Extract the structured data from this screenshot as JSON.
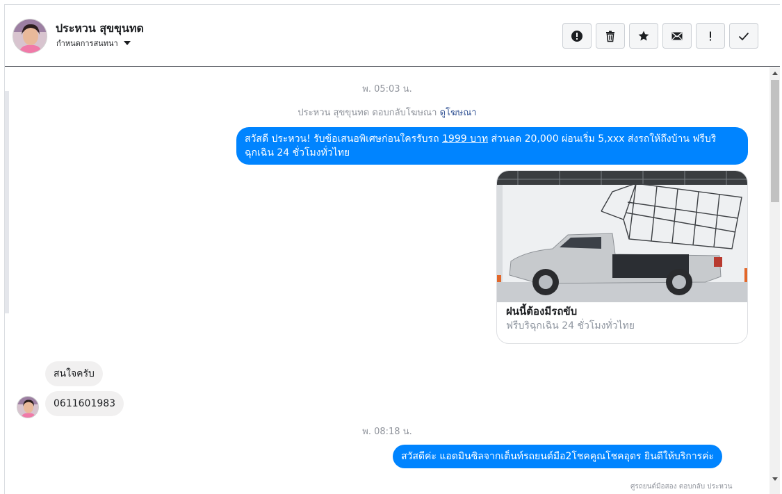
{
  "header": {
    "contact_name": "ประหวน สุขขุนทด",
    "sub_label": "กำหนดการสนทนา",
    "actions": [
      {
        "name": "report-button",
        "icon": "alert-circle-icon"
      },
      {
        "name": "delete-button",
        "icon": "trash-icon"
      },
      {
        "name": "star-button",
        "icon": "star-icon"
      },
      {
        "name": "mark-unread-button",
        "icon": "envelope-icon"
      },
      {
        "name": "important-button",
        "icon": "exclamation-icon"
      },
      {
        "name": "mark-done-button",
        "icon": "check-icon"
      }
    ]
  },
  "conversation": {
    "time_1": "พ. 05:03 น.",
    "ad_notice": {
      "text": "ประหวน สุขขุนทด ตอบกลับโฆษณา ",
      "link": "ดูโฆษณา"
    },
    "outgoing_1": {
      "part_a": "สวัสดี ประหวน! รับข้อเสนอพิเศษก่อนใครรับรถ ",
      "underline": "1999 บาท",
      "part_b": " ส่วนลด 20,000  ผ่อนเริ่ม 5,xxx ส่งรถให้ถึงบ้าน ฟรีบริ",
      "line_2": "ฉุกเฉิน 24 ชั่วโมงทั่วไทย"
    },
    "card": {
      "title": "ฝนนี้ต้องมีรถขับ",
      "subtitle": "ฟรีบริฉุกเฉิน 24 ชั่วโมงทั่วไทย"
    },
    "incoming_1": "สนใจครับ",
    "incoming_2": "0611601983",
    "time_2": "พ. 08:18 น.",
    "outgoing_2": "สวัสดีค่ะ แอดมินซิลจากเต็นท์รถยนต์มือ2โชคคูณโชคอุดร ยินดีให้บริการค่ะ",
    "cut_note": "ศูรถยนต์มือสอง ตอบกลับ ประหวน"
  },
  "colors": {
    "accent": "#0084ff",
    "incoming_bubble": "#f1f0f0",
    "muted_text": "#90949c",
    "link": "#385898"
  }
}
